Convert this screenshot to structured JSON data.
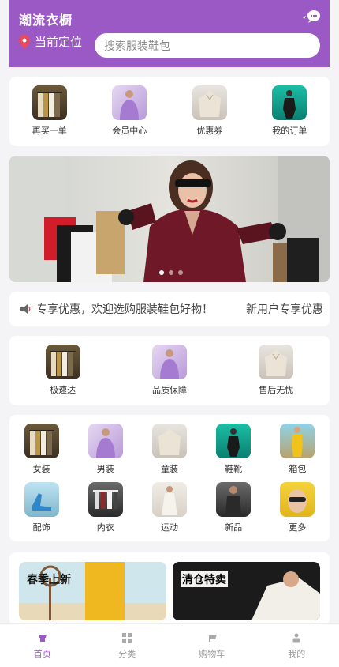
{
  "header": {
    "title": "潮流衣橱",
    "location_label": "当前定位",
    "search_placeholder": "搜索服装鞋包"
  },
  "quick_menu": [
    {
      "label": "再买一单",
      "icon": "clothes-rack-thumb"
    },
    {
      "label": "会员中心",
      "icon": "purple-dress-thumb"
    },
    {
      "label": "优惠券",
      "icon": "beige-sweater-thumb"
    },
    {
      "label": "我的订单",
      "icon": "teal-fashion-thumb"
    }
  ],
  "banner": {
    "slides": 3,
    "active_index": 0
  },
  "notice": {
    "text": "专享优惠，欢迎选购服装鞋包好物！",
    "text_next": "新用户专享优惠"
  },
  "services": [
    {
      "label": "极速达"
    },
    {
      "label": "品质保障"
    },
    {
      "label": "售后无忧"
    }
  ],
  "categories": [
    {
      "label": "女装"
    },
    {
      "label": "男装"
    },
    {
      "label": "童装"
    },
    {
      "label": "鞋靴"
    },
    {
      "label": "箱包"
    },
    {
      "label": "配饰"
    },
    {
      "label": "内衣"
    },
    {
      "label": "运动"
    },
    {
      "label": "新品"
    },
    {
      "label": "更多"
    }
  ],
  "promos": [
    {
      "title": "春季上新"
    },
    {
      "title": "清仓特卖"
    }
  ],
  "tabbar": [
    {
      "label": "首页",
      "active": true
    },
    {
      "label": "分类",
      "active": false
    },
    {
      "label": "购物车",
      "active": false
    },
    {
      "label": "我的",
      "active": false
    }
  ],
  "colors": {
    "primary": "#9b59c6",
    "background": "#f4f4f6"
  }
}
